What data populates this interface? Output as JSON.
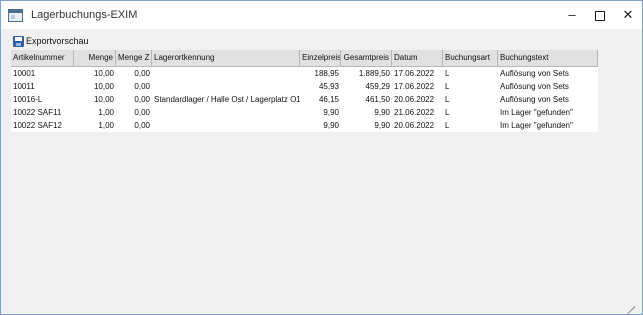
{
  "window": {
    "title": "Lagerbuchungs-EXIM",
    "minimize_glyph": "–",
    "close_glyph": "✕"
  },
  "toolbar": {
    "export_label": "Exportvorschau",
    "export_icon": "save-icon"
  },
  "table": {
    "columns": [
      "Artikelnummer",
      "Menge",
      "Menge Z",
      "Lagerortkennung",
      "Einzelpreis",
      "Gesamtpreis",
      "Datum",
      "Buchungsart",
      "Buchungstext"
    ],
    "rows": [
      [
        "10001",
        "10,00",
        "0,00",
        "",
        "188,95",
        "1.889,50",
        "17.06.2022",
        "L",
        "Auflösung von Sets"
      ],
      [
        "10011",
        "10,00",
        "0,00",
        "",
        "45,93",
        "459,29",
        "17.06.2022",
        "L",
        "Auflösung von Sets"
      ],
      [
        "10016-L",
        "10,00",
        "0,00",
        "Standardlager / Halle Ost / Lagerplatz O1",
        "46,15",
        "461,50",
        "20.06.2022",
        "L",
        "Auflösung von Sets"
      ],
      [
        "10022 SAF11",
        "1,00",
        "0,00",
        "",
        "9,90",
        "9,90",
        "21.06.2022",
        "L",
        "Im Lager \"gefunden\""
      ],
      [
        "10022 SAF12",
        "1,00",
        "0,00",
        "",
        "9,90",
        "9,90",
        "20.06.2022",
        "L",
        "Im Lager \"gefunden\""
      ]
    ]
  }
}
